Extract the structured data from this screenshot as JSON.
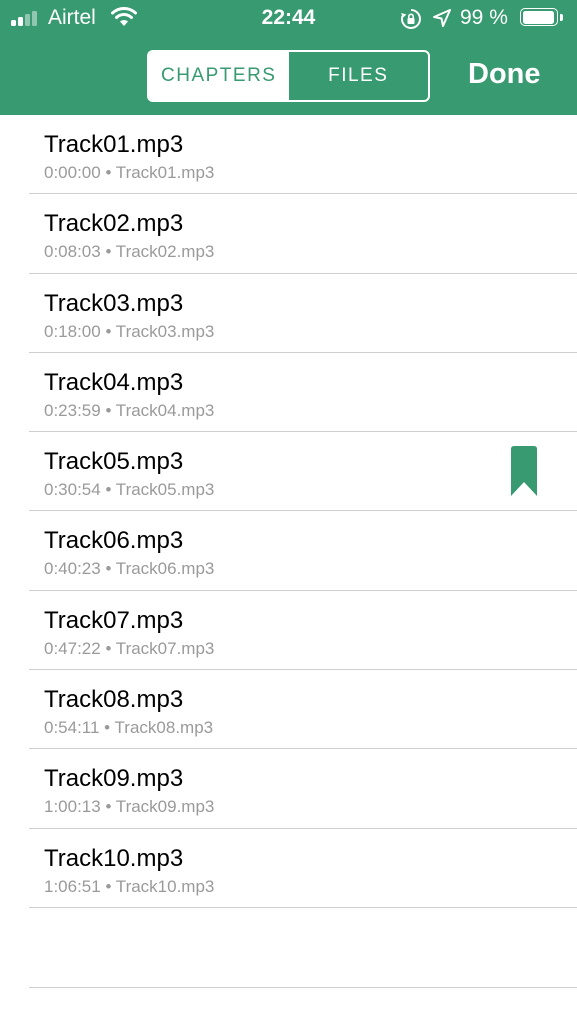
{
  "status_bar": {
    "carrier": "Airtel",
    "time": "22:44",
    "battery": "99 %",
    "battery_level": 0.99
  },
  "segment": {
    "chapters_label": "CHAPTERS",
    "files_label": "FILES",
    "selected": "chapters"
  },
  "header": {
    "done_label": "Done"
  },
  "colors": {
    "accent": "#379a70",
    "separator": "#cfcfd3",
    "subtitle": "#9a9a9a"
  },
  "chapters": [
    {
      "title": "Track01.mp3",
      "subtitle": "0:00:00 • Track01.mp3",
      "bookmarked": false
    },
    {
      "title": "Track02.mp3",
      "subtitle": "0:08:03 • Track02.mp3",
      "bookmarked": false
    },
    {
      "title": "Track03.mp3",
      "subtitle": "0:18:00 • Track03.mp3",
      "bookmarked": false
    },
    {
      "title": "Track04.mp3",
      "subtitle": "0:23:59 • Track04.mp3",
      "bookmarked": false
    },
    {
      "title": "Track05.mp3",
      "subtitle": "0:30:54 • Track05.mp3",
      "bookmarked": true
    },
    {
      "title": "Track06.mp3",
      "subtitle": "0:40:23 • Track06.mp3",
      "bookmarked": false
    },
    {
      "title": "Track07.mp3",
      "subtitle": "0:47:22 • Track07.mp3",
      "bookmarked": false
    },
    {
      "title": "Track08.mp3",
      "subtitle": "0:54:11 • Track08.mp3",
      "bookmarked": false
    },
    {
      "title": "Track09.mp3",
      "subtitle": "1:00:13 • Track09.mp3",
      "bookmarked": false
    },
    {
      "title": "Track10.mp3",
      "subtitle": "1:06:51 • Track10.mp3",
      "bookmarked": false
    }
  ]
}
